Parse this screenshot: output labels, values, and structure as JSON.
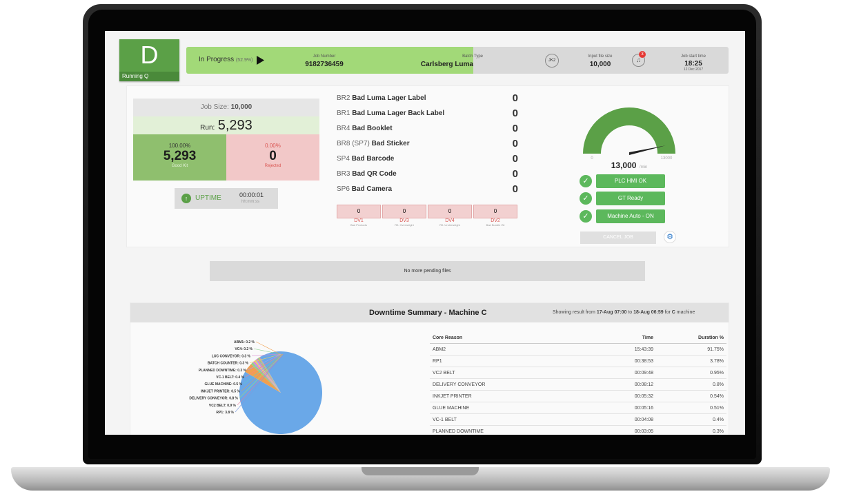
{
  "status_tile": {
    "letter": "D",
    "sub": "Running Q"
  },
  "topbar": {
    "status": "In Progress",
    "percent": "(52.9%)",
    "job_number_label": "Job Number",
    "job_number": "9182736459",
    "batch_type_label": "Batch Type",
    "batch_type": "Carlsberg Luma",
    "user_badge": "JK2",
    "input_size_label": "Input file size",
    "input_size": "10,000",
    "notif_count": "3",
    "start_label": "Job start time",
    "start_time": "18:25",
    "start_date": "12 Dec 2017"
  },
  "job": {
    "size_label": "Job Size:",
    "size": "10,000",
    "run_label": "Run:",
    "run": "5,293",
    "good_pct": "100.00%",
    "good": "5,293",
    "good_label": "Good Kit",
    "rej_pct": "0.00%",
    "rejected": "0",
    "rej_label": "Rejected",
    "uptime_label": "UPTIME",
    "uptime": "00:00:01",
    "uptime_unit": "hh:mm:ss"
  },
  "defects": [
    {
      "code": "BR2",
      "name": "Bad Luma Lager Label",
      "value": "0"
    },
    {
      "code": "BR1",
      "name": "Bad Luma Lager Back Label",
      "value": "0"
    },
    {
      "code": "BR4",
      "name": "Bad Booklet",
      "value": "0"
    },
    {
      "code": "BR8 (SP7)",
      "name": "Bad Sticker",
      "value": "0"
    },
    {
      "code": "SP4",
      "name": "Bad Barcode",
      "value": "0"
    },
    {
      "code": "BR3",
      "name": "Bad QR Code",
      "value": "0"
    },
    {
      "code": "SP6",
      "name": "Bad Camera",
      "value": "0"
    }
  ],
  "dv": [
    {
      "value": "0",
      "label": "DV1",
      "sub": "Bad Products"
    },
    {
      "value": "0",
      "label": "DV3",
      "sub": "Rft. Overweight"
    },
    {
      "value": "0",
      "label": "DV4",
      "sub": "Rft. Underweight"
    },
    {
      "value": "0",
      "label": "DV2",
      "sub": "Bad Bundle Wt"
    }
  ],
  "gauge": {
    "value": "13,000",
    "unit": "/min",
    "min": "0",
    "max": "13000",
    "fraction": 0.93
  },
  "status_buttons": [
    "PLC HMI OK",
    "GT Ready",
    "Machine Auto - ON"
  ],
  "cancel_label": "CANCEL JOB",
  "pending": "No more pending files",
  "downtime": {
    "title": "Downtime Summary - Machine C",
    "range_prefix": "Showing result from ",
    "range_from": "17-Aug 07:00",
    "range_mid": " to ",
    "range_to": "18-Aug 06:59",
    "range_suffix": " for ",
    "machine": "C",
    "range_end": " machine",
    "headers": [
      "Core Reason",
      "Time",
      "Duration %"
    ],
    "rows": [
      [
        "ABM2",
        "15:43:39",
        "91.75%"
      ],
      [
        "RP1",
        "00:38:53",
        "3.78%"
      ],
      [
        "VC2 BELT",
        "00:09:48",
        "0.95%"
      ],
      [
        "DELIVERY CONVEYOR",
        "00:08:12",
        "0.8%"
      ],
      [
        "INKJET PRINTER",
        "00:05:32",
        "0.54%"
      ],
      [
        "GLUE MACHINE",
        "00:05:16",
        "0.51%"
      ],
      [
        "VC-1 BELT",
        "00:04:08",
        "0.4%"
      ],
      [
        "PLANNED DOWNTIME",
        "00:03:05",
        "0.3%"
      ]
    ],
    "pie_labels": [
      "ABM1: 0.2 %",
      "VC4: 0.2 %",
      "LUC CONVEYOR: 0.3 %",
      "BATCH COUNTER: 0.3 %",
      "PLANNED DOWNTIME: 0.3 %",
      "VC-1 BELT: 0.4 %",
      "GLUE MACHINE: 0.5 %",
      "INKJET PRINTER: 0.5 %",
      "DELIVERY CONVEYOR: 0.8 %",
      "VC2 BELT: 0.9 %",
      "RP1: 3.8 %"
    ],
    "pie_values": [
      91.75,
      3.78,
      0.95,
      0.8,
      0.54,
      0.51,
      0.4,
      0.3,
      0.3,
      0.3,
      0.2,
      0.2
    ],
    "pie_colors": [
      "#6aa8e8",
      "#f0a050",
      "#8fd18f",
      "#d98bd1",
      "#f2d35c",
      "#a0a0ff",
      "#ff8080",
      "#60c9c9",
      "#c9a06e",
      "#9be07a",
      "#e07aa0",
      "#7a9be0"
    ]
  },
  "colors": {
    "green": "#5ba047",
    "progress": "#a2d978",
    "reject": "#f2c8c8",
    "pie_main": "#6aa8e8"
  }
}
